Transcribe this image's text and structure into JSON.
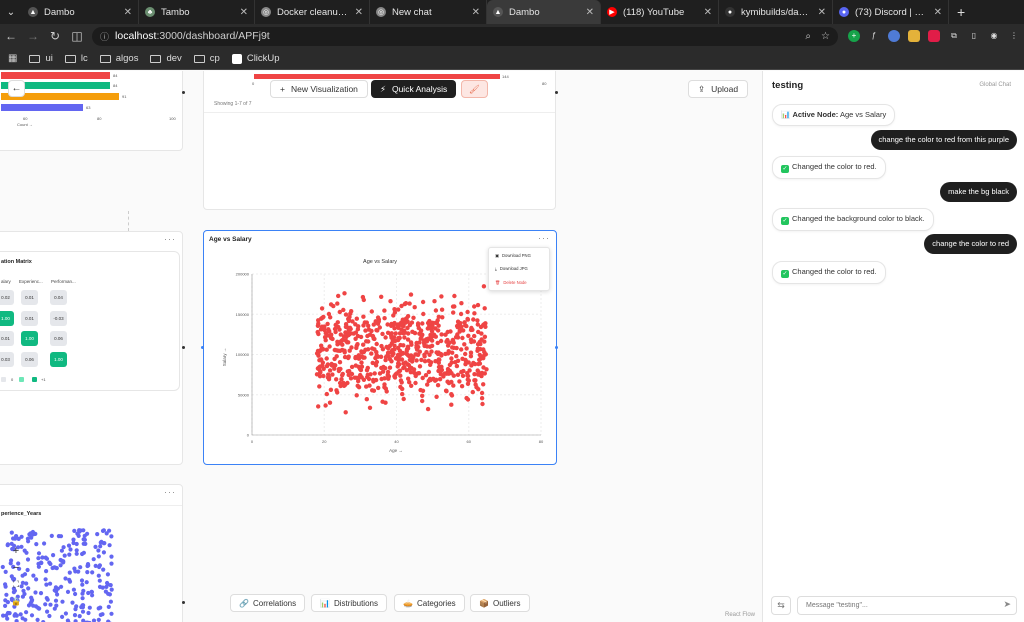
{
  "browser": {
    "tabs": [
      {
        "title": "Dambo",
        "color": "#555555",
        "glyph": "▲",
        "active": false
      },
      {
        "title": "Tambo",
        "color": "#6b8f71",
        "glyph": "♣",
        "active": false
      },
      {
        "title": "Docker cleanup gui",
        "color": "#888888",
        "glyph": "◎",
        "active": false
      },
      {
        "title": "New chat",
        "color": "#888888",
        "glyph": "◎",
        "active": false
      },
      {
        "title": "Dambo",
        "color": "#555555",
        "glyph": "▲",
        "active": true
      },
      {
        "title": "(118) YouTube",
        "color": "#ff0000",
        "glyph": "▶",
        "active": false
      },
      {
        "title": "kymibuilds/dambo",
        "color": "#333333",
        "glyph": "●",
        "active": false
      },
      {
        "title": "(73) Discord | @DR",
        "color": "#5865f2",
        "glyph": "●",
        "active": false
      }
    ],
    "url_host": "localhost",
    "url_path": ":3000/dashboard/APFj9t",
    "bookmarks": [
      "ui",
      "lc",
      "algos",
      "dev",
      "cp",
      "ClickUp"
    ]
  },
  "canvas": {
    "controls": {
      "new_viz": "New Visualization",
      "quick_analysis": "Quick Analysis",
      "upload": "Upload"
    },
    "bar_node": {
      "values": [
        "84",
        "84",
        "91",
        "63"
      ],
      "colors": [
        "#ef4444",
        "#10b981",
        "#f59e0b",
        "#6366f1"
      ],
      "ticks": [
        "60",
        "80",
        "100"
      ],
      "axis_label": "Count →"
    },
    "table_node": {
      "bar_value": "144",
      "left_tick": "0",
      "right_tick": "80",
      "showing": "Showing 1-7 of 7"
    },
    "matrix_node": {
      "title": "ation Matrix",
      "headers": [
        "alary",
        "Experienc...",
        "Performan..."
      ],
      "rows": [
        [
          "0.02",
          "0.01",
          "0.04"
        ],
        [
          "1.00",
          "0.01",
          "-0.03"
        ],
        [
          "0.01",
          "1.00",
          "0.06"
        ],
        [
          "0.03",
          "0.06",
          "1.00"
        ]
      ],
      "legend": [
        "0",
        "+1"
      ]
    },
    "scatter_node": {
      "node_title": "Age vs Salary",
      "menu": [
        "Download PNG",
        "Download JPG",
        "Delete Node"
      ]
    },
    "exp_node": {
      "title": "perience_Years",
      "zoom": [
        "+",
        "−",
        "⛶",
        "🔒"
      ]
    },
    "chips": [
      {
        "icon": "🔗",
        "label": "Correlations"
      },
      {
        "icon": "📊",
        "label": "Distributions"
      },
      {
        "icon": "🥧",
        "label": "Categories"
      },
      {
        "icon": "📦",
        "label": "Outliers"
      }
    ],
    "attribution": "React Flow"
  },
  "chart_data": {
    "type": "scatter",
    "title": "Age vs Salary",
    "xlabel": "Age →",
    "ylabel": "Salary →",
    "xlim": [
      0,
      80
    ],
    "ylim": [
      0,
      200000
    ],
    "xticks": [
      "0",
      "20",
      "40",
      "60",
      "80"
    ],
    "yticks": [
      "0",
      "50000",
      "100000",
      "150000",
      "200000"
    ],
    "color": "#ef4444",
    "points_summary": {
      "x_range": [
        18,
        65
      ],
      "y_range": [
        20000,
        195000
      ],
      "approx_count": 1000
    }
  },
  "chat": {
    "title": "testing",
    "subtitle": "Global Chat",
    "messages": [
      {
        "role": "ai",
        "text": "Active Node: Age vs Salary",
        "bold": "Active Node:",
        "rest": " Age vs Salary",
        "icon": "📊"
      },
      {
        "role": "user",
        "text": "change the color to red from this purple"
      },
      {
        "role": "ai",
        "text": "Changed the color to red."
      },
      {
        "role": "user",
        "text": "make the bg black"
      },
      {
        "role": "ai",
        "text": "Changed the background color to black."
      },
      {
        "role": "user",
        "text": "change the color to red"
      },
      {
        "role": "ai",
        "text": "Changed the color to red."
      }
    ],
    "placeholder": "Message \"testing\"..."
  }
}
